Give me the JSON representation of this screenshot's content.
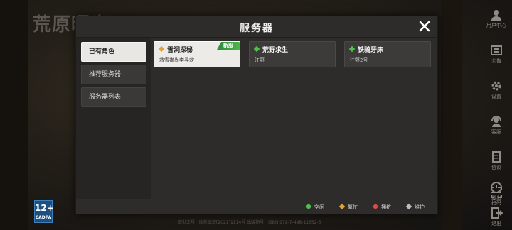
{
  "background": {
    "logo_text": "荒原曙光",
    "age_rating": {
      "number": "12+",
      "sub": "CADPA"
    },
    "footer": "审批文号：国新出审[2021]1114号  出版物号：ISBN 978-7-498-11652-5"
  },
  "side_menu": {
    "items": [
      {
        "label": "用户中心",
        "icon": "user-icon"
      },
      {
        "label": "公告",
        "icon": "notice-icon"
      },
      {
        "label": "设置",
        "icon": "gear-icon"
      },
      {
        "label": "客服",
        "icon": "support-icon"
      },
      {
        "label": "协议",
        "icon": "document-icon"
      },
      {
        "label": "扫码",
        "icon": "qr-scan-icon"
      }
    ],
    "bottom": [
      {
        "label": "登出",
        "icon": "logout-icon"
      },
      {
        "label": "退出",
        "icon": "exit-icon"
      }
    ]
  },
  "dialog": {
    "title": "服务器",
    "close_icon": "close-icon",
    "tabs": [
      {
        "label": "已有角色",
        "active": true
      },
      {
        "label": "推荐服务器",
        "active": false
      },
      {
        "label": "服务器列表",
        "active": false
      }
    ],
    "servers": [
      {
        "name": "雪洞探秘",
        "sub": "救雪崔尚李寻欢",
        "status": "busy",
        "tag": "新服",
        "selected": true
      },
      {
        "name": "荒野求生",
        "sub": "江野",
        "status": "idle",
        "tag": "",
        "selected": false
      },
      {
        "name": "铁骑牙床",
        "sub": "江野2号",
        "status": "idle",
        "tag": "",
        "selected": false
      }
    ],
    "legend": [
      {
        "label": "空闲",
        "status": "idle"
      },
      {
        "label": "繁忙",
        "status": "busy"
      },
      {
        "label": "拥挤",
        "status": "crowded"
      },
      {
        "label": "维护",
        "status": "maintenance"
      }
    ]
  },
  "colors": {
    "idle": "#4cc24c",
    "busy": "#e3a43c",
    "crowded": "#e04a4a",
    "maintenance": "#bdbdbd",
    "new_tag": "#3fa847"
  }
}
